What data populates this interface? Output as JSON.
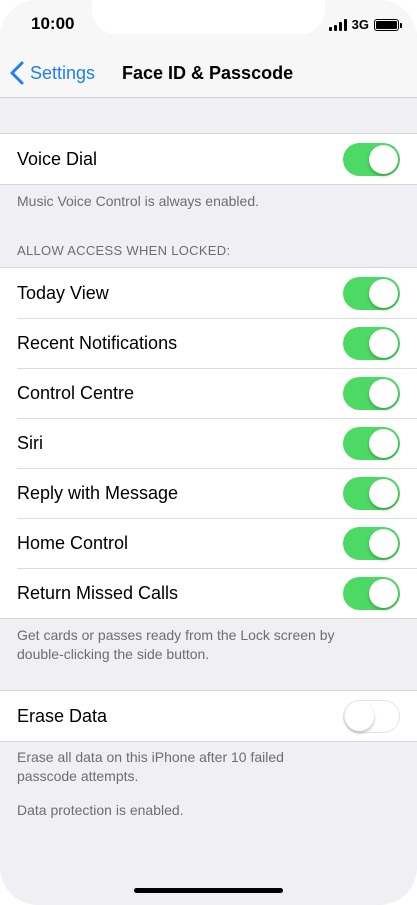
{
  "status_bar": {
    "time": "10:00",
    "network": "3G"
  },
  "nav": {
    "back_label": "Settings",
    "title": "Face ID & Passcode"
  },
  "voice_group": {
    "label": "Voice Dial",
    "on": true,
    "footer": "Music Voice Control is always enabled."
  },
  "locked_access": {
    "header": "ALLOW ACCESS WHEN LOCKED:",
    "items": [
      {
        "label": "Today View",
        "on": true
      },
      {
        "label": "Recent Notifications",
        "on": true
      },
      {
        "label": "Control Centre",
        "on": true
      },
      {
        "label": "Siri",
        "on": true
      },
      {
        "label": "Reply with Message",
        "on": true
      },
      {
        "label": "Home Control",
        "on": true
      },
      {
        "label": "Return Missed Calls",
        "on": true
      }
    ],
    "footer_line1": "Get cards or passes ready from the Lock screen by",
    "footer_line2": "double-clicking the side button."
  },
  "erase_group": {
    "label": "Erase Data",
    "on": false,
    "footer_line1": "Erase all data on this iPhone after 10 failed",
    "footer_line2": "passcode attempts.",
    "footer_note": "Data protection is enabled."
  },
  "colors": {
    "accent": "#1f7ef5",
    "toggle_on": "#4cd964",
    "background": "#efeff4"
  }
}
